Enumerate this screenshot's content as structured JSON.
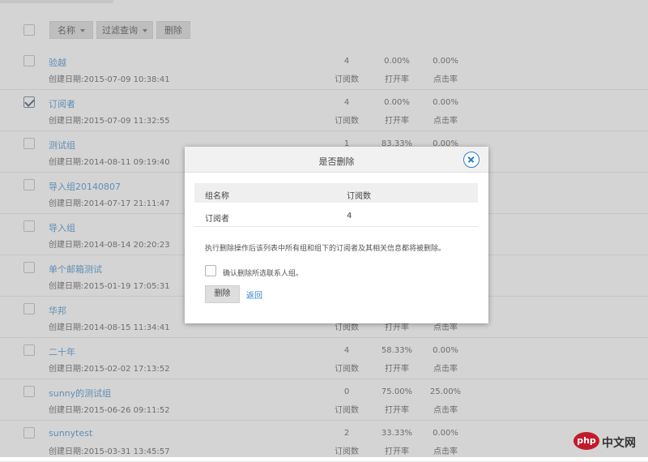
{
  "toolbar": {
    "name_label": "名称",
    "filter_label": "过滤查询",
    "delete_label": "删除"
  },
  "groups": [
    {
      "name": "验越",
      "date": "创建日期:2015-07-09 10:38:41",
      "subs": "4",
      "subs_label": "订阅数",
      "open_rate": "0.00%",
      "open_label": "打开率",
      "click_rate": "0.00%",
      "click_label": "点击率",
      "checked": false
    },
    {
      "name": "订阅者",
      "date": "创建日期:2015-07-09 11:32:55",
      "subs": "4",
      "subs_label": "订阅数",
      "open_rate": "0.00%",
      "open_label": "打开率",
      "click_rate": "0.00%",
      "click_label": "点击率",
      "checked": true
    },
    {
      "name": "测试组",
      "date": "创建日期:2014-08-11 09:19:40",
      "subs": "1",
      "subs_label": "",
      "open_rate": "83.33%",
      "open_label": "",
      "click_rate": "0.00%",
      "click_label": "",
      "checked": false
    },
    {
      "name": "导入组20140807",
      "date": "创建日期:2014-07-17 21:11:47",
      "subs": "",
      "subs_label": "",
      "open_rate": "",
      "open_label": "",
      "click_rate": "",
      "click_label": "",
      "checked": false
    },
    {
      "name": "导入组",
      "date": "创建日期:2014-08-14 20:20:23",
      "subs": "",
      "subs_label": "",
      "open_rate": "",
      "open_label": "",
      "click_rate": "",
      "click_label": "",
      "checked": false
    },
    {
      "name": "单个邮箱测试",
      "date": "创建日期:2015-01-19 17:05:31",
      "subs": "",
      "subs_label": "",
      "open_rate": "",
      "open_label": "",
      "click_rate": "",
      "click_label": "",
      "checked": false
    },
    {
      "name": "华邦",
      "date": "创建日期:2014-08-15 11:34:41",
      "subs": "",
      "subs_label": "订阅数",
      "open_rate": "",
      "open_label": "打开率",
      "click_rate": "",
      "click_label": "点击率",
      "checked": false
    },
    {
      "name": "二十年",
      "date": "创建日期:2015-02-02 17:13:52",
      "subs": "4",
      "subs_label": "订阅数",
      "open_rate": "58.33%",
      "open_label": "打开率",
      "click_rate": "0.00%",
      "click_label": "点击率",
      "checked": false
    },
    {
      "name": "sunny的测试组",
      "date": "创建日期:2015-06-26 09:11:52",
      "subs": "0",
      "subs_label": "订阅数",
      "open_rate": "75.00%",
      "open_label": "打开率",
      "click_rate": "25.00%",
      "click_label": "点击率",
      "checked": false
    },
    {
      "name": "sunnytest",
      "date": "创建日期:2015-03-31 13:45:57",
      "subs": "2",
      "subs_label": "订阅数",
      "open_rate": "33.33%",
      "open_label": "打开率",
      "click_rate": "0.00%",
      "click_label": "点击率",
      "checked": false
    }
  ],
  "modal": {
    "title": "是否删除",
    "table": {
      "col_name": "组名称",
      "col_subs": "订阅数",
      "row_name": "订阅者",
      "row_subs": "4"
    },
    "warning": "执行删除操作后该列表中所有组和组下的订阅者及其相关信息都将被删除。",
    "confirm_label": "确认删除所选联系人组。",
    "delete_label": "删除",
    "back_label": "返回"
  },
  "watermark": {
    "badge": "php",
    "text": "中文网",
    "brand_color": "#c11b2b"
  }
}
